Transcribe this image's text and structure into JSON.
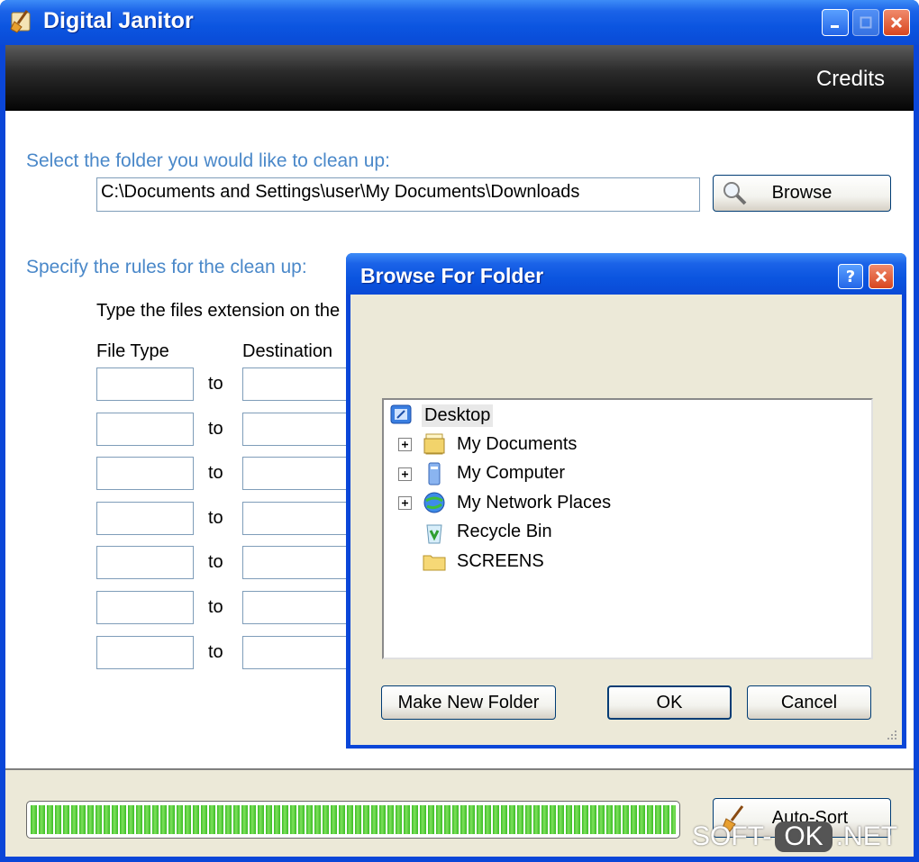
{
  "window": {
    "title": "Digital Janitor",
    "credits_label": "Credits"
  },
  "folder_section": {
    "label": "Select the folder you would like to clean up:",
    "path_value": "C:\\Documents and Settings\\user\\My Documents\\Downloads",
    "browse_label": "Browse"
  },
  "rules_section": {
    "label": "Specify the rules for the clean up:",
    "instruction": "Type the files extension on the",
    "col_file_type": "File Type",
    "col_destination": "Destination",
    "to_word": "to",
    "rows": [
      {
        "file_type": "",
        "destination": ""
      },
      {
        "file_type": "",
        "destination": ""
      },
      {
        "file_type": "",
        "destination": ""
      },
      {
        "file_type": "",
        "destination": ""
      },
      {
        "file_type": "",
        "destination": ""
      },
      {
        "file_type": "",
        "destination": ""
      },
      {
        "file_type": "",
        "destination": ""
      }
    ]
  },
  "bottom": {
    "progress_percent": 100,
    "autosort_label": "Auto-Sort"
  },
  "dialog": {
    "title": "Browse For Folder",
    "help_glyph": "?",
    "tree": {
      "root": "Desktop",
      "items": [
        "My Documents",
        "My Computer",
        "My Network Places",
        "Recycle Bin",
        "SCREENS"
      ]
    },
    "make_new_folder_label": "Make New Folder",
    "ok_label": "OK",
    "cancel_label": "Cancel"
  },
  "watermark": {
    "part1": "SOFT-",
    "part2": "OK",
    "part3": ".NET"
  },
  "colors": {
    "xp_blue": "#0a46d8",
    "label_blue": "#4a88c9",
    "progress_green": "#3bbd25"
  }
}
